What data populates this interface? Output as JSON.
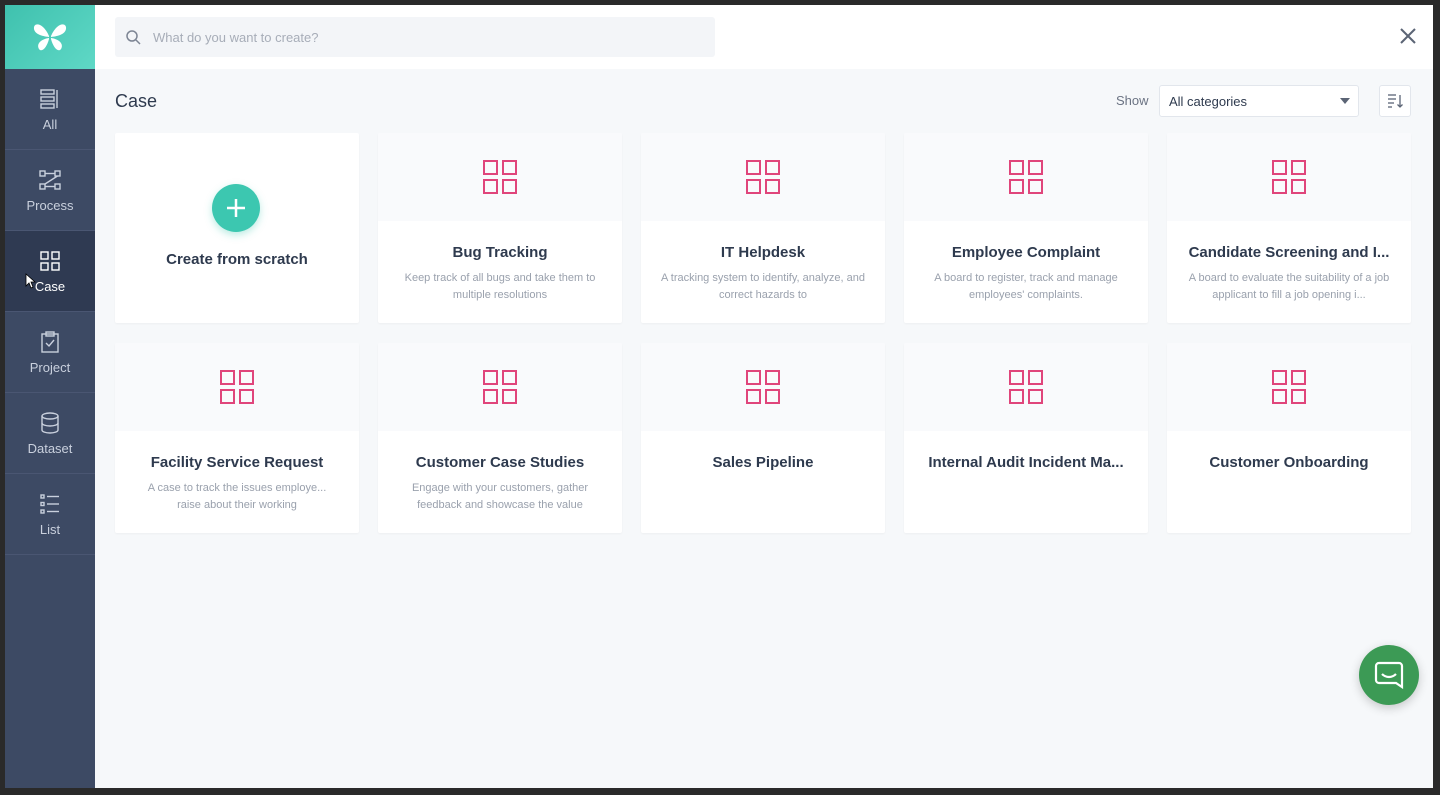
{
  "search": {
    "placeholder": "What do you want to create?"
  },
  "sidebar": {
    "items": [
      {
        "label": "All",
        "icon": "list-bars-icon"
      },
      {
        "label": "Process",
        "icon": "process-flow-icon"
      },
      {
        "label": "Case",
        "icon": "grid-icon"
      },
      {
        "label": "Project",
        "icon": "clipboard-check-icon"
      },
      {
        "label": "Dataset",
        "icon": "database-icon"
      },
      {
        "label": "List",
        "icon": "checklist-icon"
      }
    ],
    "active": "Case"
  },
  "page": {
    "title": "Case",
    "show_label": "Show",
    "category_select": "All categories"
  },
  "scratch": {
    "label": "Create from scratch"
  },
  "cards": [
    {
      "title": "Bug Tracking",
      "desc": "Keep track of all bugs and take them to multiple resolutions"
    },
    {
      "title": "IT Helpdesk",
      "desc": "A tracking system to identify, analyze, and correct hazards to"
    },
    {
      "title": "Employee Complaint",
      "desc": "A board to register, track and manage employees' complaints."
    },
    {
      "title": "Candidate Screening and I...",
      "desc": "A board to evaluate the suitability of a job applicant to fill a job opening i..."
    },
    {
      "title": "Facility Service Request",
      "desc": "A case to track the issues employe... raise about their working"
    },
    {
      "title": "Customer Case Studies",
      "desc": "Engage with your customers, gather feedback and showcase the value"
    },
    {
      "title": "Sales Pipeline",
      "desc": ""
    },
    {
      "title": "Internal Audit Incident Ma...",
      "desc": ""
    },
    {
      "title": "Customer Onboarding",
      "desc": ""
    }
  ],
  "colors": {
    "sidebar_bg": "#3d4a64",
    "sidebar_active": "#2f3a52",
    "accent_teal": "#3cc7b0",
    "card_icon": "#e0457b",
    "chat_green": "#3c9a55"
  }
}
